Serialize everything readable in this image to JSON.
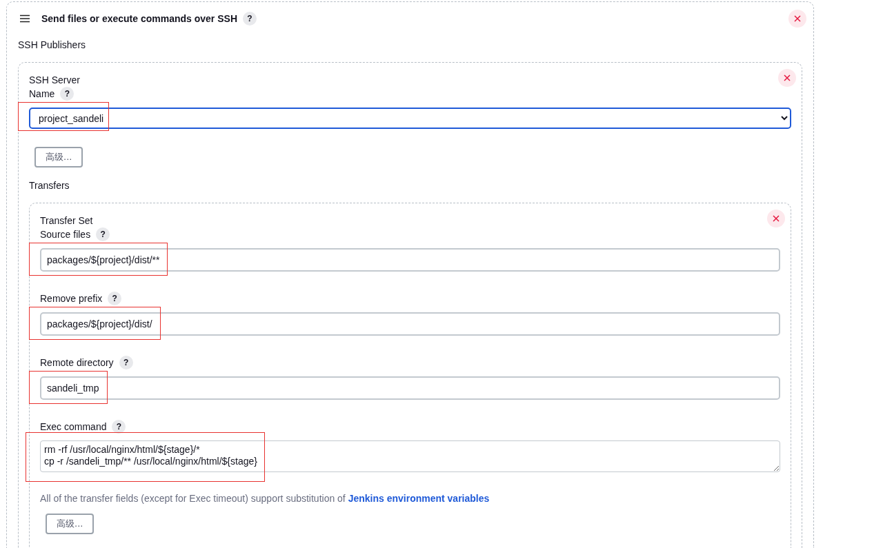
{
  "section": {
    "title": "Send files or execute commands over SSH",
    "help": "?",
    "subtitle": "SSH Publishers"
  },
  "server": {
    "heading": "SSH Server",
    "name_label": "Name",
    "help": "?",
    "name_value": "project_sandeli",
    "highlighted": true,
    "advanced_button": "高级..."
  },
  "transfers_label": "Transfers",
  "transfer_set": {
    "heading": "Transfer Set",
    "fields": [
      {
        "kind": "input",
        "label": "Source files",
        "help": "?",
        "value": "packages/${project}/dist/**",
        "highlighted": true
      },
      {
        "kind": "input",
        "label": "Remove prefix",
        "help": "?",
        "value": "packages/${project}/dist/",
        "highlighted": true
      },
      {
        "kind": "input",
        "label": "Remote directory",
        "help": "?",
        "value": "sandeli_tmp",
        "highlighted": true
      },
      {
        "kind": "textarea",
        "label": "Exec command",
        "help": "?",
        "value": "rm -rf /usr/local/nginx/html/${stage}/*\ncp -r /sandeli_tmp/** /usr/local/nginx/html/${stage}",
        "highlighted": true
      }
    ],
    "note": "All of the transfer fields (except for Exec timeout) support substitution of",
    "note_link": "Jenkins environment variables",
    "advanced_button": "高级..."
  }
}
